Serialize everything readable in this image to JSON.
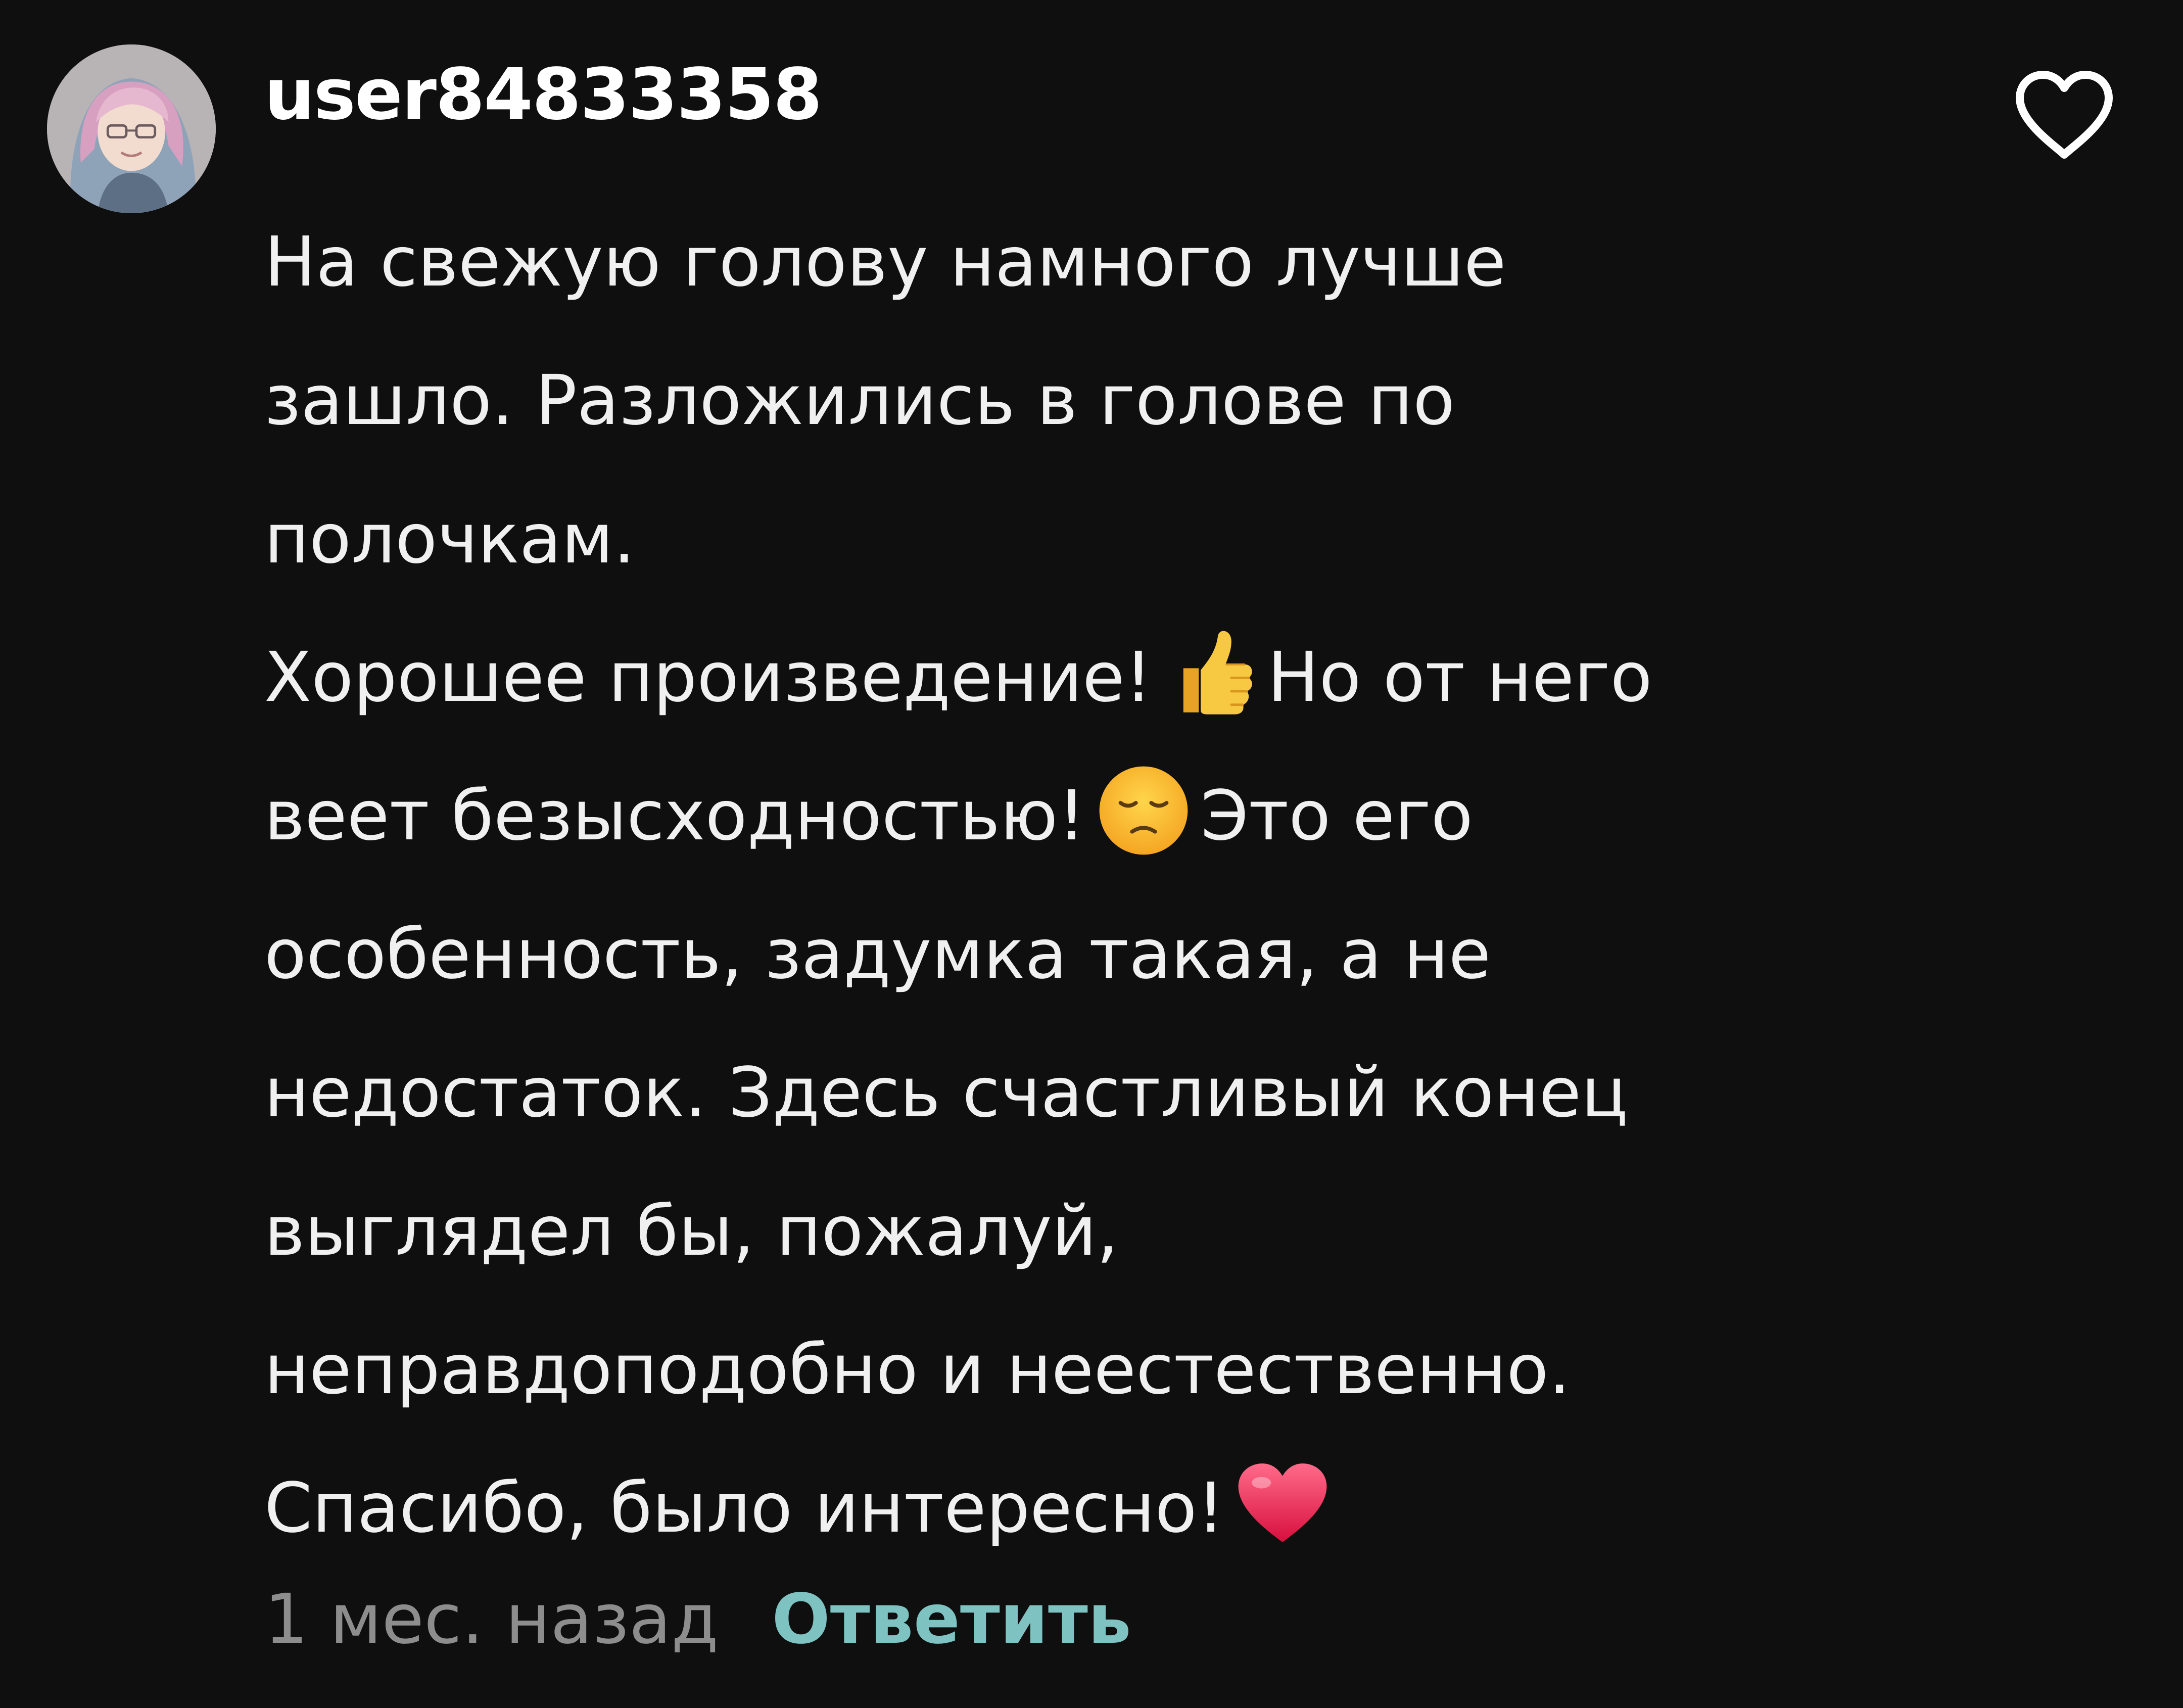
{
  "comment": {
    "username": "user84833358",
    "avatar_icon": "avatar-image",
    "like_icon": "heart-outline-icon",
    "lines": [
      "На свежую голову намного лучше",
      "зашло. Разложились в голове по",
      "полочкам.",
      "Хорошее произведение!",
      "Но от него",
      "веет безысходностью!",
      "Это его",
      "особенность, задумка такая, а не",
      "недостаток. Здесь счастливый конец",
      "выглядел бы, пожалуй,",
      "неправдоподобно и неестественно.",
      "Спасибо, было интересно!"
    ],
    "emojis": [
      "thumbs-up-emoji",
      "disappointed-face-emoji",
      "red-heart-emoji"
    ],
    "timestamp": "1 мес. назад",
    "reply_label": "Ответить"
  },
  "colors": {
    "background": "#0f0f0f",
    "text": "#f0f0f0",
    "timestamp": "#8d8d8d",
    "reply_accent": "#7ec3c2"
  }
}
